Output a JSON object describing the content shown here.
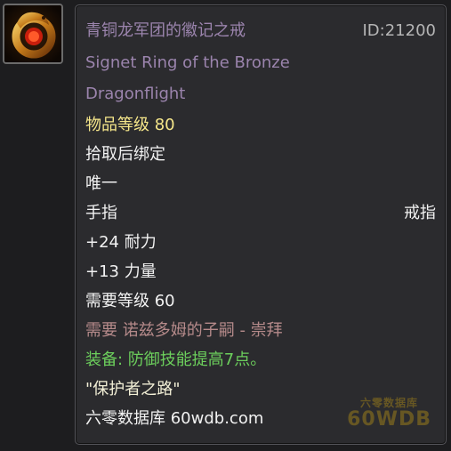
{
  "item": {
    "icon": "bronze-dragon-ring-icon",
    "name_cn": "青铜龙军团的徽记之戒",
    "id_label": "ID:21200",
    "name_en_line1": "Signet Ring of the Bronze",
    "name_en_line2": "Dragonflight",
    "item_level": "物品等级 80",
    "binding": "拾取后绑定",
    "unique": "唯一",
    "slot": "手指",
    "type": "戒指",
    "stats": [
      "+24 耐力",
      "+13 力量"
    ],
    "required_level": "需要等级 60",
    "required_reputation": "需要 诺兹多姆的子嗣 - 崇拜",
    "equip_effect": "装备: 防御技能提高7点。",
    "flavor_text": "\"保护者之路\"",
    "source": "六零数据库 60wdb.com"
  },
  "watermark": {
    "top": "六零数据库",
    "bottom": "60WDB"
  },
  "colors": {
    "name": "#9b84ad",
    "id": "#b5b5b5",
    "equip": "#6ccf5c",
    "reputation": "#b58a8a"
  }
}
